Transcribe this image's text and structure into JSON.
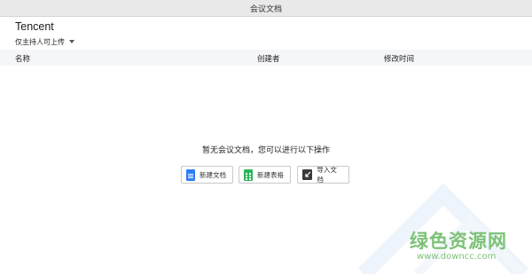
{
  "window": {
    "title": "会议文档"
  },
  "org": {
    "name": "Tencent",
    "permission": "仅主持人可上传"
  },
  "table": {
    "columns": {
      "name": "名称",
      "creator": "创建者",
      "modified": "修改时间"
    }
  },
  "empty_state": {
    "message": "暂无会议文档，您可以进行以下操作",
    "actions": [
      {
        "label": "新建文档",
        "icon": "doc-icon",
        "color": "#2f7cf6"
      },
      {
        "label": "新建表格",
        "icon": "sheet-icon",
        "color": "#2db35a"
      },
      {
        "label": "导入文档",
        "icon": "import-icon",
        "color": "#3a3a3a"
      }
    ]
  },
  "watermark": {
    "brand": "绿色资源网",
    "url": "www.downcc.com",
    "color": "#7cc276"
  }
}
